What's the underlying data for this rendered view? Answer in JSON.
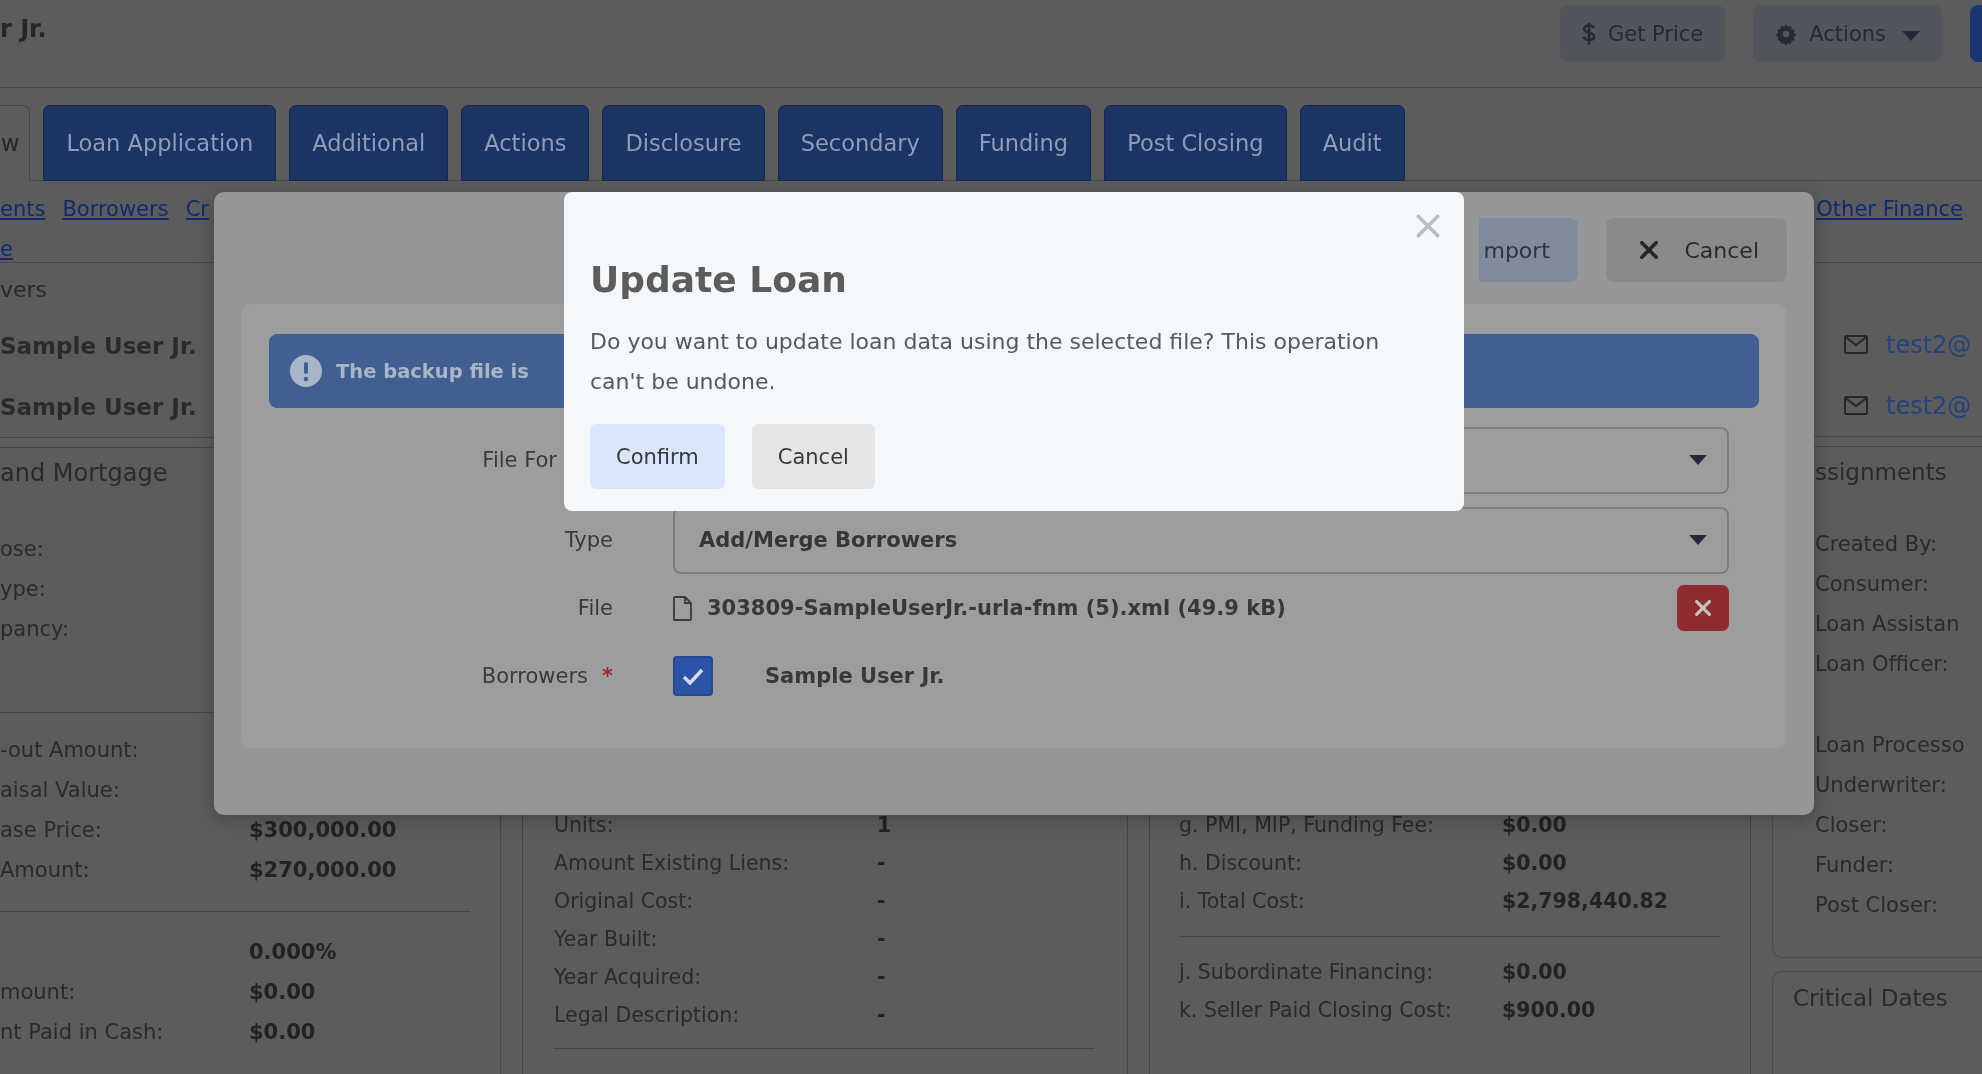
{
  "header": {
    "title": "r Jr.",
    "buttons": [
      {
        "kind": "price",
        "label": "Get Price"
      },
      {
        "kind": "menu",
        "label": "Actions"
      },
      {
        "kind": "partial"
      }
    ]
  },
  "tabs": [
    {
      "label": "w",
      "selected": true
    },
    {
      "label": "Loan Application",
      "selected": false
    },
    {
      "label": "Additional",
      "selected": false
    },
    {
      "label": "Actions",
      "selected": false
    },
    {
      "label": "Disclosure",
      "selected": false
    },
    {
      "label": "Secondary",
      "selected": false
    },
    {
      "label": "Funding",
      "selected": false
    },
    {
      "label": "Post Closing",
      "selected": false
    },
    {
      "label": "Audit",
      "selected": false
    }
  ],
  "subnav": {
    "left": [
      "ents",
      "Borrowers",
      "Cr"
    ],
    "right": [
      "Other Finance"
    ],
    "second_line": [
      "e"
    ]
  },
  "left_column": {
    "heading": "vers",
    "borrowers": [
      "Sample User Jr.",
      "Sample User Jr."
    ],
    "section_title": "and Mortgage",
    "labels": [
      "ose:",
      "ype:",
      "pancy:"
    ],
    "amounts": [
      {
        "label": "-out Amount:"
      },
      {
        "label": "aisal Value:"
      },
      {
        "label": "ase Price:",
        "value": "$300,000.00"
      },
      {
        "label": "Amount:",
        "value": "$270,000.00"
      }
    ],
    "rates": [
      {
        "value": "0.000%"
      },
      {
        "label": "mount:",
        "value": "$0.00"
      },
      {
        "label": "nt Paid in Cash:",
        "value": "$0.00"
      }
    ]
  },
  "property_column": {
    "rows": [
      {
        "label": "Units:",
        "value": "1"
      },
      {
        "label": "Amount Existing Liens:",
        "value": "-"
      },
      {
        "label": "Original Cost:",
        "value": "-"
      },
      {
        "label": "Year Built:",
        "value": "-"
      },
      {
        "label": "Year Acquired:",
        "value": "-"
      },
      {
        "label": "Legal Description:",
        "value": "-"
      }
    ]
  },
  "cost_column": {
    "rows": [
      {
        "label": "g. PMI, MIP, Funding Fee:",
        "value": "$0.00"
      },
      {
        "label": "h. Discount:",
        "value": "$0.00"
      },
      {
        "label": "i. Total Cost:",
        "value": "$2,798,440.82"
      }
    ],
    "rows_after_rule": [
      {
        "label": "j. Subordinate Financing:",
        "value": "$0.00"
      },
      {
        "label": "k. Seller Paid Closing Cost:",
        "value": "$900.00"
      }
    ]
  },
  "right_column": {
    "emails": [
      "test2@",
      "test2@"
    ],
    "assignments": {
      "title": "ssignments",
      "groups": [
        [
          "Created By:",
          "Consumer:",
          "Loan Assistan",
          "Loan Officer:"
        ],
        [
          "Loan Processo",
          "Underwriter:",
          "Closer:",
          "Funder:",
          "Post Closer:"
        ]
      ]
    },
    "critical_dates": {
      "title": "Critical Dates"
    }
  },
  "import_modal": {
    "buttons": [
      {
        "kind": "import",
        "label": "mport"
      },
      {
        "kind": "cancel",
        "label": "Cancel"
      }
    ],
    "alert": "The backup file is",
    "fields": [
      {
        "kind": "select",
        "label": "File For"
      },
      {
        "kind": "select",
        "label": "Type",
        "value": "Add/Merge Borrowers"
      },
      {
        "kind": "file",
        "label": "File",
        "value": "303809-SampleUserJr.-urla-fnm (5).xml (49.9 kB)"
      },
      {
        "kind": "checkbox",
        "label": "Borrowers",
        "required_mark": "*",
        "value": "Sample User Jr.",
        "checked": true
      }
    ]
  },
  "confirm_dialog": {
    "title": "Update Loan",
    "message": "Do you want to update loan data using the selected file? This operation can't be undone.",
    "buttons": [
      {
        "kind": "primary",
        "label": "Confirm"
      },
      {
        "kind": "secondary",
        "label": "Cancel"
      }
    ]
  }
}
